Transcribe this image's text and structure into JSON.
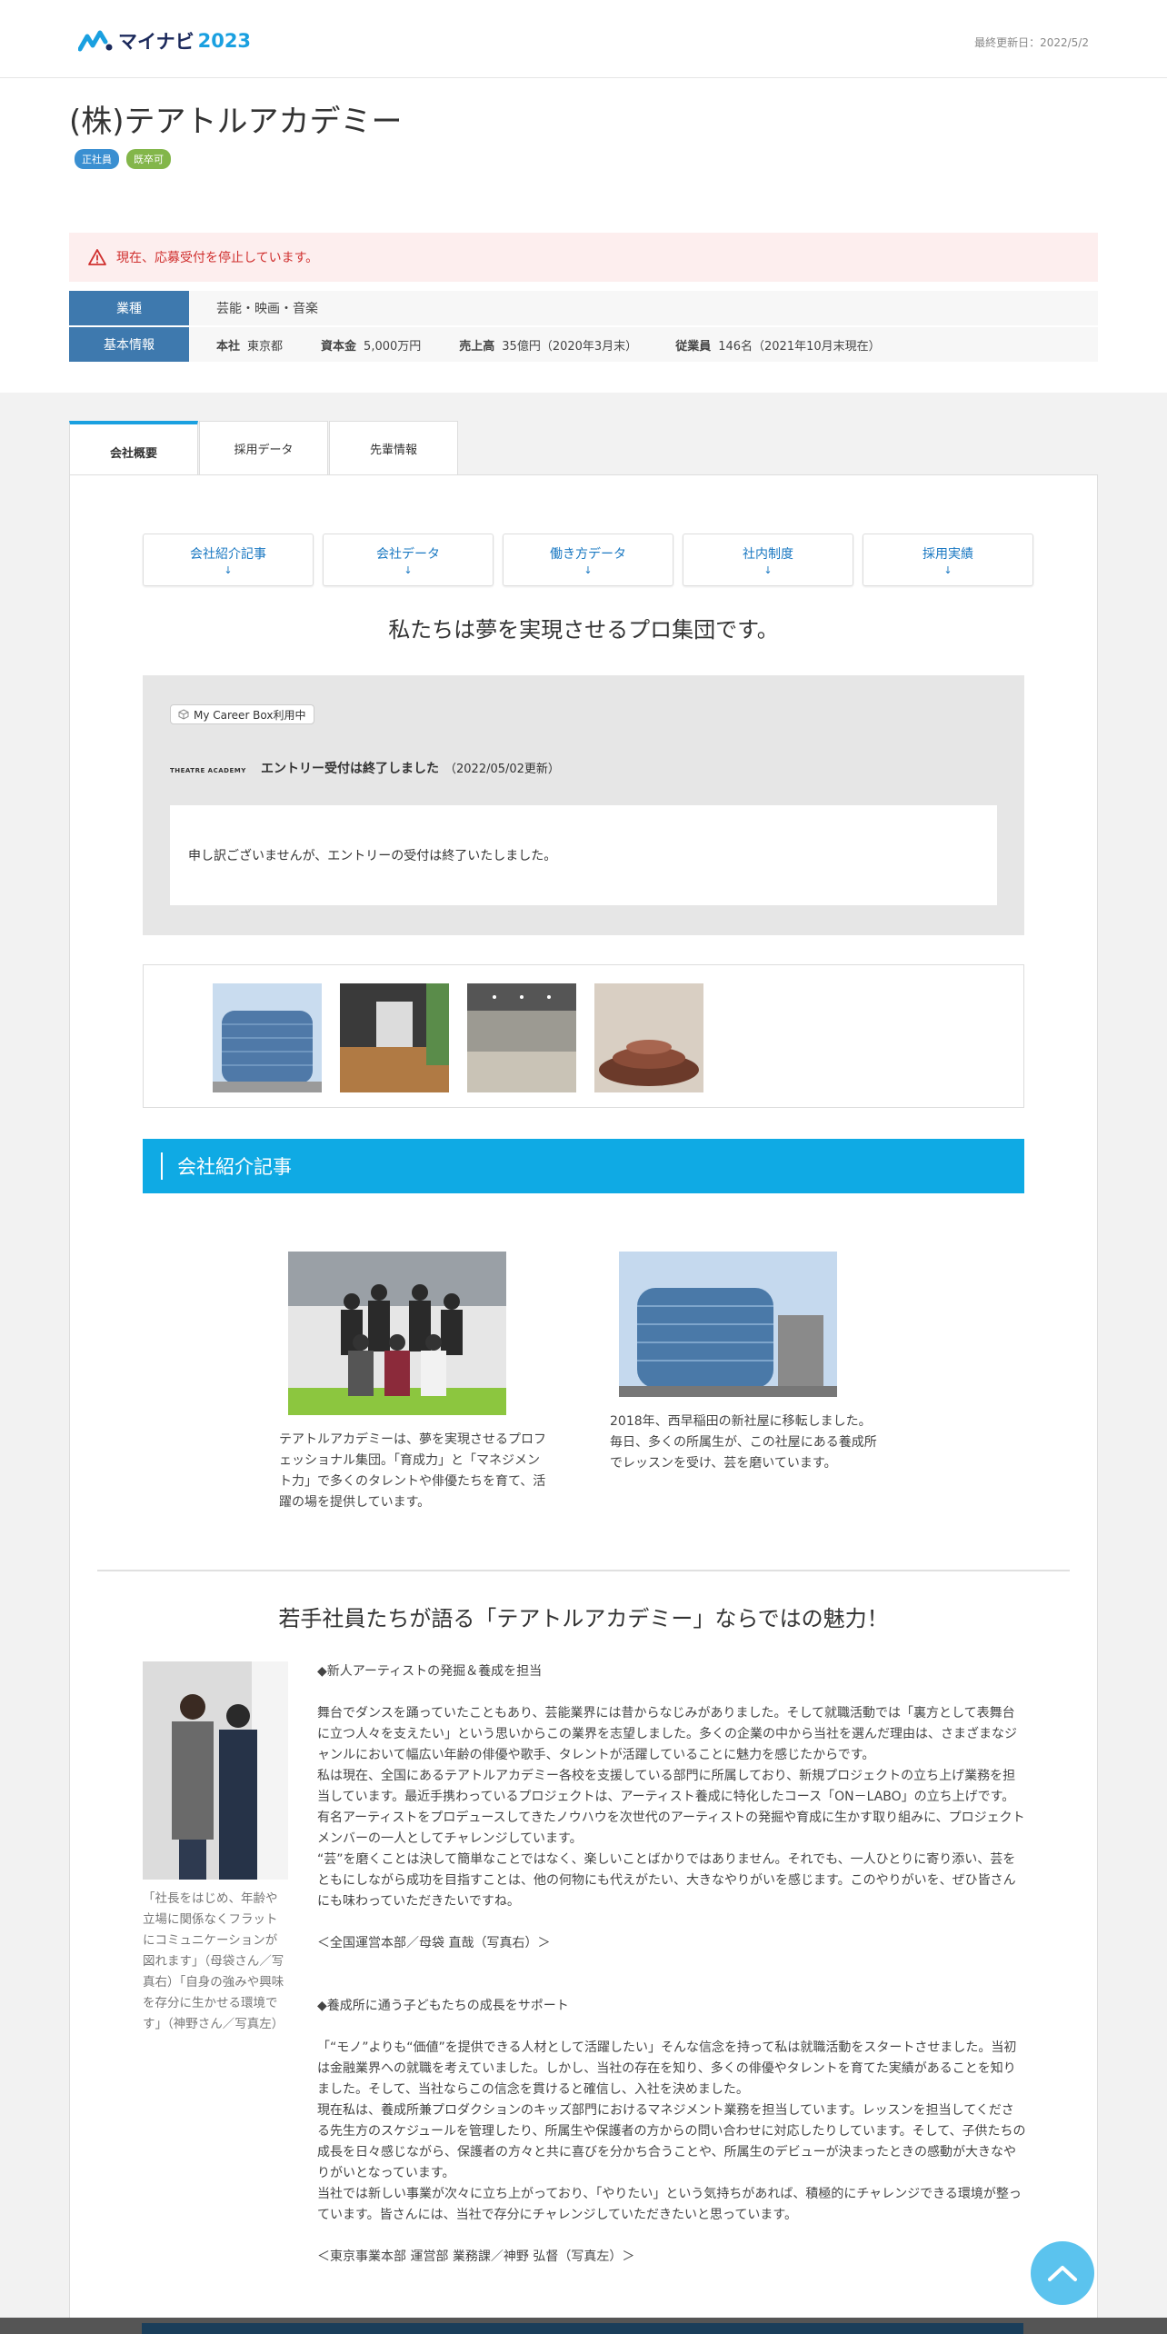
{
  "header": {
    "logo_text": "マイナビ",
    "logo_year": "2023",
    "updated": "最終更新日：2022/5/2"
  },
  "company": {
    "name": "(株)テアトルアカデミー",
    "tags": [
      "正社員",
      "既卒可"
    ]
  },
  "alert": {
    "text": "現在、応募受付を停止しています。"
  },
  "industry": {
    "label": "業種",
    "value": "芸能・映画・音楽"
  },
  "basic": {
    "label": "基本情報",
    "items": [
      {
        "key": "本社",
        "value": "東京都"
      },
      {
        "key": "資本金",
        "value": "5,000万円"
      },
      {
        "key": "売上高",
        "value": "35億円（2020年3月末）"
      },
      {
        "key": "従業員",
        "value": "146名（2021年10月末現在）"
      }
    ]
  },
  "tabs": [
    "会社概要",
    "採用データ",
    "先輩情報"
  ],
  "subnav": [
    "会社紹介記事",
    "会社データ",
    "働き方データ",
    "社内制度",
    "採用実績"
  ],
  "subnav_arrow": "↓",
  "catch": "私たちは夢を実現させるプロ集団です。",
  "entry": {
    "mcb": "My Career Box利用中",
    "logo_text": "THEATRE ACADEMY",
    "status": "エントリー受付は終了しました",
    "updated": "（2022/05/02更新）",
    "message": "申し訳ございませんが、エントリーの受付は終了いたしました。"
  },
  "section_title": "会社紹介記事",
  "articles": [
    {
      "caption": "テアトルアカデミーは、夢を実現させるプロフェッショナル集団。「育成力」と「マネジメント力」で多くのタレントや俳優たちを育て、活躍の場を提供しています。"
    },
    {
      "caption": "2018年、西早稲田の新社屋に移転しました。毎日、多くの所属生が、この社屋にある養成所でレッスンを受け、芸を磨いています。"
    }
  ],
  "interview_title": "若手社員たちが語る「テアトルアカデミー」ならではの魅力！",
  "portrait_caption": "「社長をはじめ、年齢や立場に関係なくフラットにコミュニケーションが図れます」（母袋さん／写真右）「自身の強みや興味を存分に生かせる環境です」（神野さん／写真左）",
  "interview": {
    "block1": {
      "head": "◆新人アーティストの発掘＆養成を担当",
      "paras": [
        "舞台でダンスを踊っていたこともあり、芸能業界には昔からなじみがありました。そして就職活動では「裏方として表舞台に立つ人々を支えたい」という思いからこの業界を志望しました。多くの企業の中から当社を選んだ理由は、さまざまなジャンルにおいて幅広い年齢の俳優や歌手、タレントが活躍していることに魅力を感じたからです。",
        "私は現在、全国にあるテアトルアカデミー各校を支援している部門に所属しており、新規プロジェクトの立ち上げ業務を担当しています。最近手携わっているプロジェクトは、アーティスト養成に特化したコース「ON－LABO」の立ち上げです。有名アーティストをプロデュースしてきたノウハウを次世代のアーティストの発掘や育成に生かす取り組みに、プロジェクトメンバーの一人としてチャレンジしています。",
        "“芸”を磨くことは決して簡単なことではなく、楽しいことばかりではありません。それでも、一人ひとりに寄り添い、芸をともにしながら成功を目指すことは、他の何物にも代えがたい、大きなやりがいを感じます。このやりがいを、ぜひ皆さんにも味わっていただきたいですね。"
      ],
      "sign": "＜全国運営本部／母袋 直哉（写真右）＞"
    },
    "block2": {
      "head": "◆養成所に通う子どもたちの成長をサポート",
      "paras": [
        "「“モノ”よりも“価値”を提供できる人材として活躍したい」そんな信念を持って私は就職活動をスタートさせました。当初は金融業界への就職を考えていました。しかし、当社の存在を知り、多くの俳優やタレントを育てた実績があることを知りました。そして、当社ならこの信念を貫けると確信し、入社を決めました。",
        "現在私は、養成所兼プロダクションのキッズ部門におけるマネジメント業務を担当しています。レッスンを担当してくださる先生方のスケジュールを管理したり、所属生や保護者の方からの問い合わせに対応したりしています。そして、子供たちの成長を日々感じながら、保護者の方々と共に喜びを分かち合うことや、所属生のデビューが決まったときの感動が大きなやりがいとなっています。",
        "当社では新しい事業が次々に立ち上がっており、「やりたい」という気持ちがあれば、積極的にチャレンジできる環境が整っています。皆さんには、当社で存分にチャレンジしていただきたいと思っています。"
      ],
      "sign": "＜東京事業本部 運営部 業務課／神野 弘督（写真左）＞"
    }
  },
  "colors": {
    "accent": "#0faae4",
    "label_blue": "#3e79ae",
    "alert_red": "#d0302f"
  }
}
